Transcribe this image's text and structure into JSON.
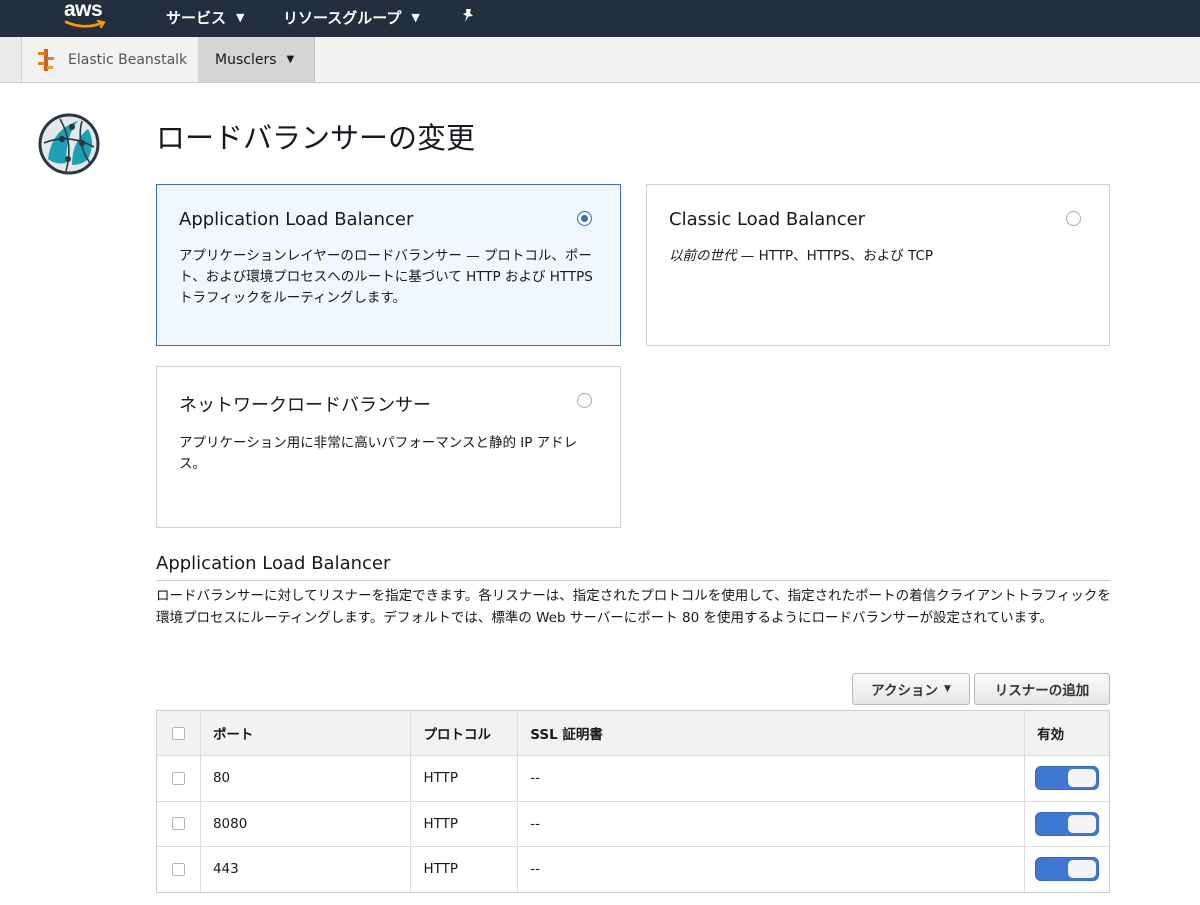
{
  "topnav": {
    "logo_text": "aws",
    "services_label": "サービス",
    "resource_groups_label": "リソースグループ",
    "colors": {
      "background": "#232f3e",
      "logo_smile": "#ff9900"
    }
  },
  "subnav": {
    "service_label": "Elastic Beanstalk",
    "environment_label": "Musclers"
  },
  "page": {
    "title": "ロードバランサーの変更"
  },
  "lb_options": [
    {
      "title": "Application Load Balancer",
      "description": "アプリケーションレイヤーのロードバランサー — プロトコル、ポート、および環境プロセスへのルートに基づいて HTTP および HTTPS トラフィックをルーティングします。",
      "selected": true
    },
    {
      "title": "Classic Load Balancer",
      "description_italic": "以前の世代",
      "description": " — HTTP、HTTPS、および TCP",
      "selected": false
    },
    {
      "title": "ネットワークロードバランサー",
      "description": "アプリケーション用に非常に高いパフォーマンスと静的 IP アドレス。",
      "selected": false
    }
  ],
  "listeners": {
    "section_title": "Application Load Balancer",
    "description": "ロードバランサーに対してリスナーを指定できます。各リスナーは、指定されたプロトコルを使用して、指定されたポートの着信クライアントトラフィックを環境プロセスにルーティングします。デフォルトでは、標準の Web サーバーにポート 80 を使用するようにロードバランサーが設定されています。",
    "actions_button": "アクション",
    "add_button": "リスナーの追加",
    "columns": [
      "ポート",
      "プロトコル",
      "SSL 証明書",
      "有効"
    ],
    "rows": [
      {
        "port": "80",
        "protocol": "HTTP",
        "ssl": "--",
        "enabled": true
      },
      {
        "port": "8080",
        "protocol": "HTTP",
        "ssl": "--",
        "enabled": true
      },
      {
        "port": "443",
        "protocol": "HTTP",
        "ssl": "--",
        "enabled": true
      }
    ],
    "toggle_color": "#3f78d1"
  }
}
